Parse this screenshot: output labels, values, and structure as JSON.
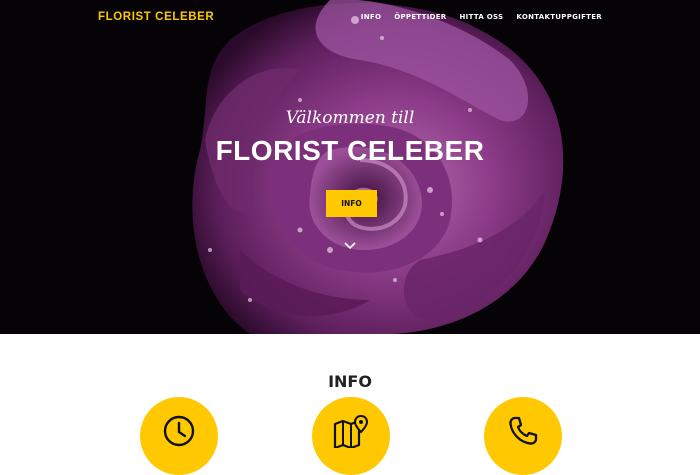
{
  "colors": {
    "accent": "#ffc800",
    "hero_bg": "#050305",
    "rose": "#8a3a86"
  },
  "nav": {
    "brand": "FLORIST CELEBER",
    "links": [
      "INFO",
      "ÖPPETTIDER",
      "HITTA OSS",
      "KONTAKTUPPGIFTER"
    ]
  },
  "hero": {
    "lead_in": "Välkommen till",
    "heading": "FLORIST CELEBER",
    "button": "INFO",
    "scroll_icon": "chevron-down-icon"
  },
  "info": {
    "title": "INFO",
    "icons": [
      "clock-icon",
      "map-pin-icon",
      "phone-icon"
    ]
  }
}
